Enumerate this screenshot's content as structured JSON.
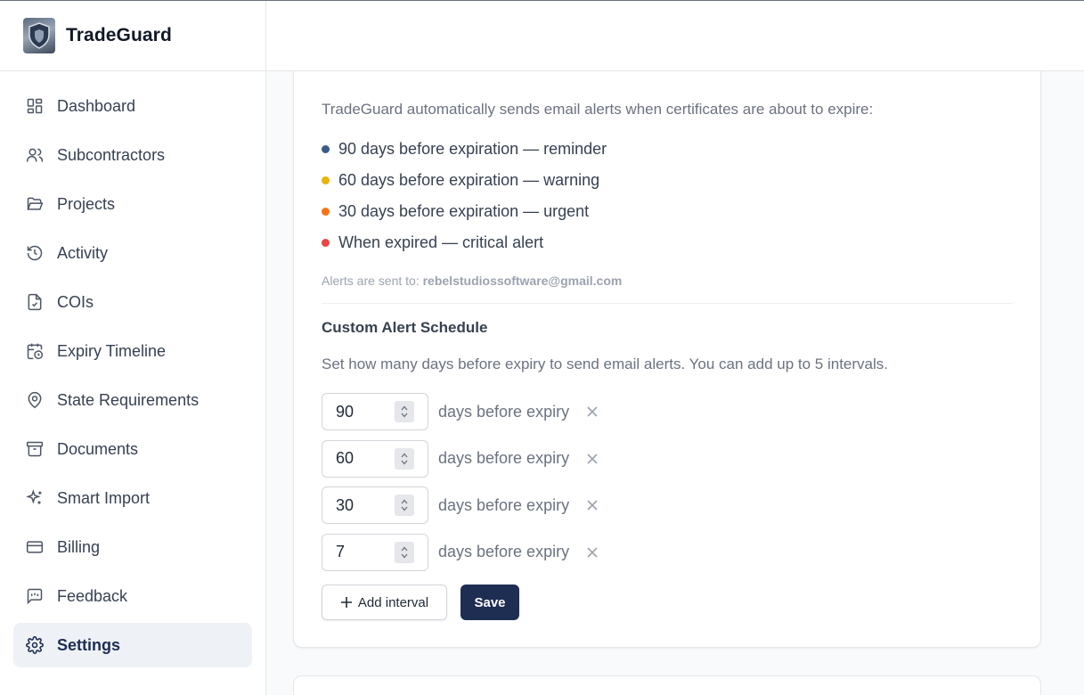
{
  "app": {
    "name": "TradeGuard"
  },
  "sidebar": {
    "items": [
      {
        "label": "Dashboard",
        "icon": "dashboard-icon",
        "active": false
      },
      {
        "label": "Subcontractors",
        "icon": "users-icon",
        "active": false
      },
      {
        "label": "Projects",
        "icon": "folder-open-icon",
        "active": false
      },
      {
        "label": "Activity",
        "icon": "history-icon",
        "active": false
      },
      {
        "label": "COIs",
        "icon": "file-check-icon",
        "active": false
      },
      {
        "label": "Expiry Timeline",
        "icon": "calendar-clock-icon",
        "active": false
      },
      {
        "label": "State Requirements",
        "icon": "map-pin-icon",
        "active": false
      },
      {
        "label": "Documents",
        "icon": "archive-icon",
        "active": false
      },
      {
        "label": "Smart Import",
        "icon": "sparkles-icon",
        "active": false
      },
      {
        "label": "Billing",
        "icon": "credit-card-icon",
        "active": false
      },
      {
        "label": "Feedback",
        "icon": "message-square-icon",
        "active": false
      },
      {
        "label": "Settings",
        "icon": "gear-icon",
        "active": true
      }
    ]
  },
  "alerts": {
    "intro": "TradeGuard automatically sends email alerts when certificates are about to expire:",
    "bullets": [
      {
        "text": "90 days before expiration — reminder",
        "color": "#3b5b8a"
      },
      {
        "text": "60 days before expiration — warning",
        "color": "#eab308"
      },
      {
        "text": "30 days before expiration — urgent",
        "color": "#f97316"
      },
      {
        "text": "When expired — critical alert",
        "color": "#ef4444"
      }
    ],
    "sent_prefix": "Alerts are sent to:",
    "sent_email": "rebelstudiossoftware@gmail.com"
  },
  "schedule": {
    "title": "Custom Alert Schedule",
    "description": "Set how many days before expiry to send email alerts. You can add up to 5 intervals.",
    "unit_label": "days before expiry",
    "intervals": [
      "90",
      "60",
      "30",
      "7"
    ],
    "add_label": "Add interval",
    "save_label": "Save"
  },
  "colors": {
    "primary": "#1e2d52",
    "active_bg": "#eef2f7"
  }
}
